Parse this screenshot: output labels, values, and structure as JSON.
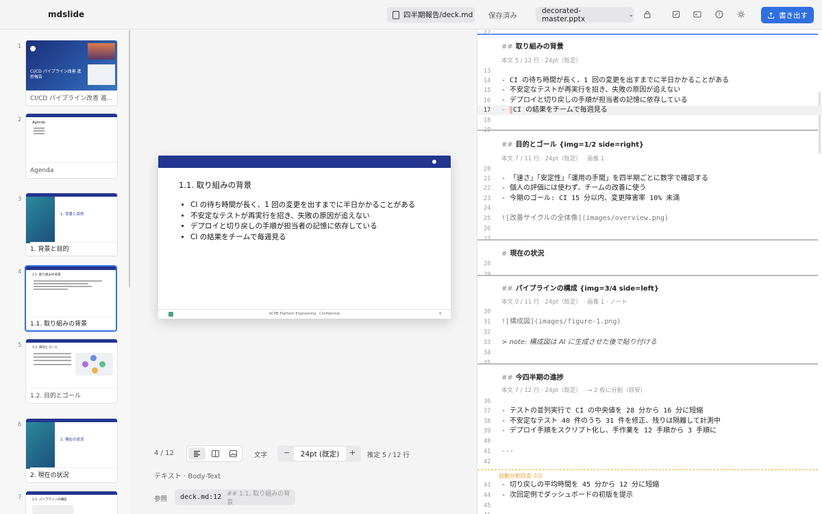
{
  "app": {
    "name": "mdslide"
  },
  "toolbar": {
    "file_name": "四半期報告/deck.md",
    "save_status": "保存済み",
    "template_name": "decorated-master.pptx",
    "export_label": "書き出す"
  },
  "thumbnails": [
    {
      "num": "1",
      "label": "CI/CD パイプライン改善 進...",
      "mini_title": "CI/CD パイプライン改善 進\n捗報告"
    },
    {
      "num": "2",
      "label": "Agenda",
      "mini_title": "Agenda"
    },
    {
      "num": "3",
      "label": "1. 背景と目的",
      "mini_title": "1. 背景と目的"
    },
    {
      "num": "4",
      "label": "1.1. 取り組みの背景",
      "mini_title": "1.1. 取り組みの背景"
    },
    {
      "num": "5",
      "label": "1.2. 目的とゴール",
      "mini_title": "1.2. 目的とゴール"
    },
    {
      "num": "6",
      "label": "2. 現在の状況",
      "mini_title": "2. 現在の状況"
    },
    {
      "num": "7",
      "label": "",
      "mini_title": "2.1. パイプラインの構成"
    }
  ],
  "slide": {
    "title": "1.1. 取り組みの背景",
    "bullets": [
      "CI の待ち時間が長く、1 回の変更を出すまでに半日かかることがある",
      "不安定なテストが再実行を招き、失敗の原因が追えない",
      "デプロイと切り戻しの手順が担当者の記憶に依存している",
      "CI の結果をチームで毎週見る"
    ],
    "footer": "ACME Platform Engineering · Confidential",
    "page": "4"
  },
  "bottom": {
    "position": "4 / 12",
    "text_label": "文字",
    "font_size": "24pt (既定)",
    "estimate": "推定 5 / 12 行",
    "placeholder_info": "テキスト · Body-Text",
    "ref_label": "参照",
    "ref_value": "deck.md:12",
    "ref_heading": "## 1.1. 取り組みの背景"
  },
  "editor": {
    "h1": "取り組みの背景",
    "m1": "本文 5 / 12 行 · 24pt（既定）",
    "l14": "- CI の待ち時間が長く、1 回の変更を出すまでに半日かかることがある",
    "l15": "- 不安定なテストが再実行を招き、失敗の原因が追えない",
    "l16": "- デプロイと切り戻しの手順が担当者の記憶に依存している",
    "l17": "CI の結果をチームで毎週見る",
    "h2": "目的とゴール {img=1/2 side=right}",
    "m2": "本文 7 / 11 行 · 24pt（既定） · 画像 1",
    "l21": "- 「速さ」「安定性」「運用の手間」を四半期ごとに数字で確認する",
    "l22": "- 個人の評価には使わず、チームの改善に使う",
    "l23": "- 今期のゴール: CI 15 分以内、変更障害率 10% 未満",
    "l25": "![改善サイクルの全体像](images/overview.png)",
    "h3": "現在の状況",
    "h4": "パイプラインの構成 {img=3/4 side=left}",
    "m4": "本文 0 / 11 行 · 24pt（既定） · 画像 1 · ノート",
    "l31": "![構成図](images/figure-1.png)",
    "l33": "> note: 構成図は AI に生成させた後で貼り付ける",
    "h5": "今四半期の進捗",
    "m5": "本文 7 / 12 行 · 24pt（既定） · → 2 枚に分割（目安）",
    "l37": "- テストの並列実行で CI の中央値を 28 分から 16 分に短縮",
    "l38": "- 不安定なテスト 40 件のうち 31 件を修正、残りは隔離して計測中",
    "l39": "- デプロイ手順をスクリプト化し、手作業を 12 手順から 3 手順に",
    "l41": "---",
    "split_label": "自動分割目安 2/2",
    "l43": "- 切り戻しの平均時間を 45 分から 12 分に短縮",
    "l44": "- 次回定例でダッシュボードの初版を提示"
  },
  "colors": {
    "accent": "#2f6fe0",
    "slide_header": "#23358f",
    "split": "#f0a830"
  }
}
